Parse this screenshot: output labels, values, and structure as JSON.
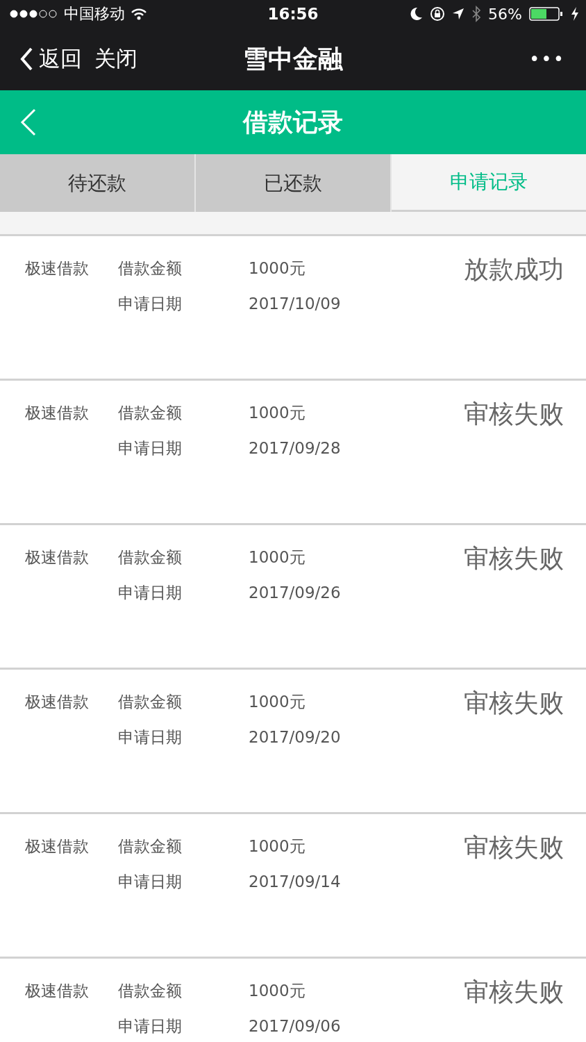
{
  "status_bar": {
    "carrier": "中国移动",
    "time": "16:56",
    "battery": "56%"
  },
  "nav_bar": {
    "back": "返回",
    "close": "关闭",
    "title": "雪中金融",
    "more": "•••"
  },
  "header": {
    "title": "借款记录"
  },
  "tabs": [
    {
      "label": "待还款",
      "selected": false
    },
    {
      "label": "已还款",
      "selected": false
    },
    {
      "label": "申请记录",
      "selected": true
    }
  ],
  "records": [
    {
      "product": "极速借款",
      "amount_label": "借款金额",
      "amount": "1000元",
      "date_label": "申请日期",
      "date": "2017/10/09",
      "status": "放款成功"
    },
    {
      "product": "极速借款",
      "amount_label": "借款金额",
      "amount": "1000元",
      "date_label": "申请日期",
      "date": "2017/09/28",
      "status": "审核失败"
    },
    {
      "product": "极速借款",
      "amount_label": "借款金额",
      "amount": "1000元",
      "date_label": "申请日期",
      "date": "2017/09/26",
      "status": "审核失败"
    },
    {
      "product": "极速借款",
      "amount_label": "借款金额",
      "amount": "1000元",
      "date_label": "申请日期",
      "date": "2017/09/20",
      "status": "审核失败"
    },
    {
      "product": "极速借款",
      "amount_label": "借款金额",
      "amount": "1000元",
      "date_label": "申请日期",
      "date": "2017/09/14",
      "status": "审核失败"
    },
    {
      "product": "极速借款",
      "amount_label": "借款金额",
      "amount": "1000元",
      "date_label": "申请日期",
      "date": "2017/09/06",
      "status": "审核失败"
    }
  ]
}
